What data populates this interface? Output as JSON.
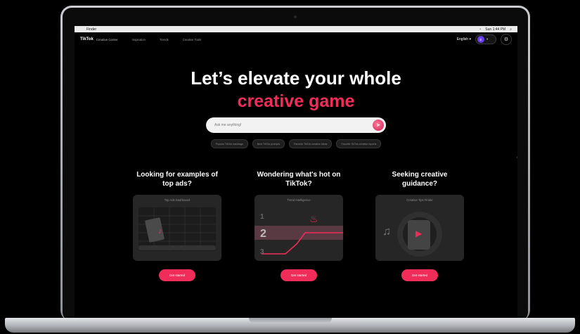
{
  "menubar": {
    "apple": "",
    "app_name": "Finder",
    "clock": "Sun 1:44 PM"
  },
  "nav": {
    "logo": "TikTok",
    "logo_sub": "Creative Center",
    "links": [
      "Inspiration",
      "Trends",
      "Creative Tools"
    ],
    "language": "English",
    "avatar_initial": "E"
  },
  "hero": {
    "line1": "Let’s elevate your whole",
    "line2": "creative game"
  },
  "search": {
    "placeholder": "Ask me anything!"
  },
  "chips": [
    "Popular TikTok hashtags",
    "Best TikTok prompts",
    "Favorite TikTok creative ideas",
    "Favorite TikTok creative reports"
  ],
  "cards": [
    {
      "title_line1": "Looking for examples of",
      "title_line2": "top ads?",
      "tile_label": "Top Ads Dashboard",
      "button": "Get started"
    },
    {
      "title_line1": "Wondering what's hot on",
      "title_line2": "TikTok?",
      "tile_label": "Trend Intelligence",
      "button": "Get started",
      "ranks": [
        "1",
        "2",
        "3"
      ]
    },
    {
      "title_line1": "Seeking creative",
      "title_line2": "guidance?",
      "tile_label": "Creative Tips Finder",
      "button": "Get started"
    }
  ],
  "colors": {
    "accent": "#f02d59",
    "avatar": "#6b3df0",
    "background": "#000000"
  },
  "icons": [
    "apple-icon",
    "wifi-icon",
    "search-icon",
    "flame-icon",
    "music-note-icon",
    "play-icon",
    "gear-icon",
    "mouse-cursor-icon"
  ]
}
